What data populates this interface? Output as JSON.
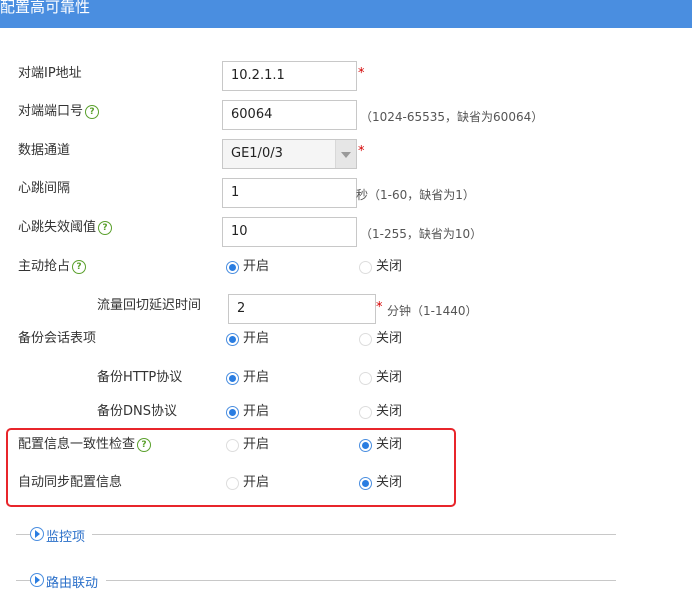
{
  "header": {
    "title": "配置高可靠性"
  },
  "form": {
    "peer_ip": {
      "label": "对端IP地址",
      "value": "10.2.1.1",
      "required": "*"
    },
    "peer_port": {
      "label": "对端端口号",
      "value": "60064",
      "hint": "（1024-65535，缺省为60064）"
    },
    "data_channel": {
      "label": "数据通道",
      "value": "GE1/0/3",
      "required": "*"
    },
    "heartbeat_interval": {
      "label": "心跳间隔",
      "value": "1",
      "hint": "秒（1-60，缺省为1）"
    },
    "heartbeat_threshold": {
      "label": "心跳失效阈值",
      "value": "10",
      "hint": "（1-255，缺省为10）"
    },
    "active_preempt": {
      "label": "主动抢占",
      "on": "开启",
      "off": "关闭",
      "selected": "on"
    },
    "failback_delay": {
      "label": "流量回切延迟时间",
      "value": "2",
      "required": "*",
      "hint": "分钟（1-1440）"
    },
    "backup_session": {
      "label": "备份会话表项",
      "on": "开启",
      "off": "关闭",
      "selected": "on"
    },
    "backup_http": {
      "label": "备份HTTP协议",
      "on": "开启",
      "off": "关闭",
      "selected": "on"
    },
    "backup_dns": {
      "label": "备份DNS协议",
      "on": "开启",
      "off": "关闭",
      "selected": "on"
    },
    "config_consistency_check": {
      "label": "配置信息一致性检查",
      "on": "开启",
      "off": "关闭",
      "selected": "off"
    },
    "auto_sync_config": {
      "label": "自动同步配置信息",
      "on": "开启",
      "off": "关闭",
      "selected": "off"
    }
  },
  "sections": [
    {
      "label": "监控项"
    },
    {
      "label": "路由联动"
    }
  ],
  "icons": {
    "help": "?",
    "help_icon": "question-circle-icon",
    "expand_icon": "play-circle-icon"
  },
  "colors": {
    "header_bg": "#4a8ee0",
    "highlight_box": "#e8252b",
    "radio_on": "#2a7de1",
    "help": "#5aa02c"
  }
}
